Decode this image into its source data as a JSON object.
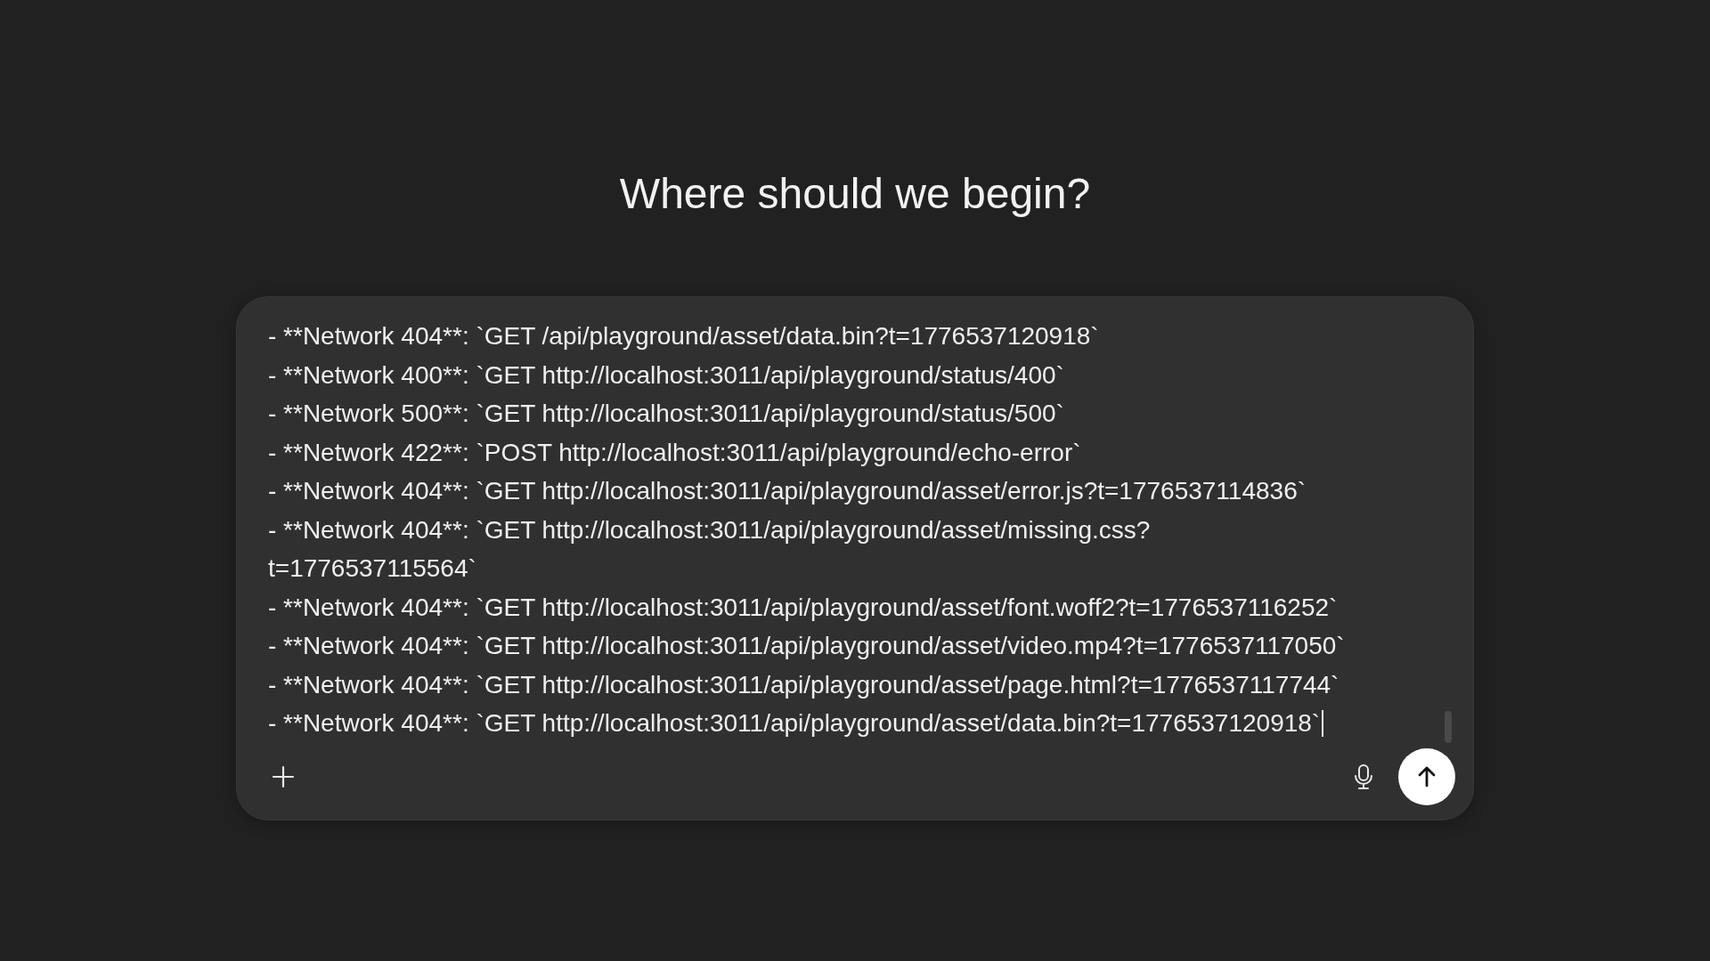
{
  "heading": "Where should we begin?",
  "composer": {
    "lines": [
      "- **Network 404**: `GET /api/playground/asset/data.bin?t=1776537120918`",
      "- **Network 400**: `GET http://localhost:3011/api/playground/status/400`",
      "- **Network 500**: `GET http://localhost:3011/api/playground/status/500`",
      "- **Network 422**: `POST http://localhost:3011/api/playground/echo-error`",
      "- **Network 404**: `GET http://localhost:3011/api/playground/asset/error.js?t=1776537114836`",
      "- **Network 404**: `GET http://localhost:3011/api/playground/asset/missing.css?",
      "t=1776537115564`",
      "- **Network 404**: `GET http://localhost:3011/api/playground/asset/font.woff2?t=1776537116252`",
      "- **Network 404**: `GET http://localhost:3011/api/playground/asset/video.mp4?t=1776537117050`",
      "- **Network 404**: `GET http://localhost:3011/api/playground/asset/page.html?t=1776537117744`",
      "- **Network 404**: `GET http://localhost:3011/api/playground/asset/data.bin?t=1776537120918`"
    ]
  }
}
